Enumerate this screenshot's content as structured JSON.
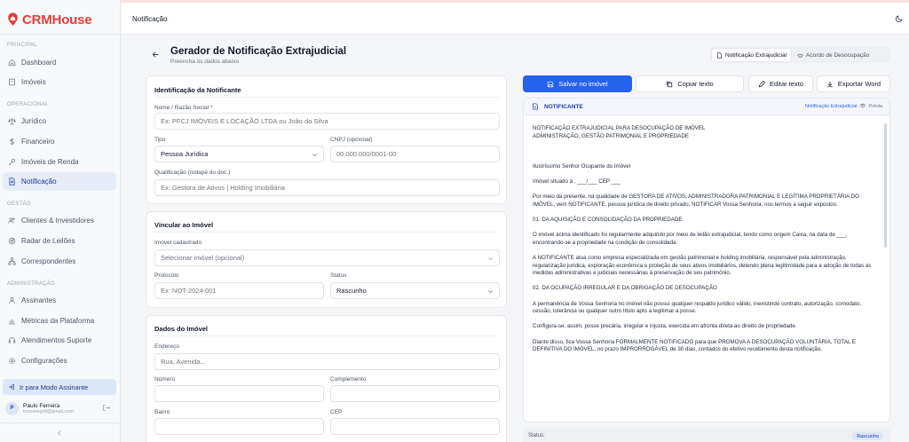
{
  "app": {
    "name": "CRMHouse",
    "brand_color": "#e0403a",
    "accent_color": "#2563eb"
  },
  "header": {
    "title": "Notificação"
  },
  "sidebar": {
    "sections": {
      "principal": "PRINCIPAL",
      "operacional": "OPERACIONAL",
      "gestao": "GESTÃO",
      "administracao": "ADMINISTRAÇÃO"
    },
    "items": [
      {
        "label": "Dashboard",
        "icon": "home-icon"
      },
      {
        "label": "Imóveis",
        "icon": "building-icon"
      },
      {
        "label": "Jurídico",
        "icon": "scale-icon"
      },
      {
        "label": "Financeiro",
        "icon": "dollar-icon"
      },
      {
        "label": "Imóveis de Renda",
        "icon": "key-icon"
      },
      {
        "label": "Notificação",
        "icon": "document-icon",
        "active": true
      },
      {
        "label": "Clientes & Investidores",
        "icon": "users-icon"
      },
      {
        "label": "Radar de Leilões",
        "icon": "radar-icon"
      },
      {
        "label": "Correspondentes",
        "icon": "network-icon"
      },
      {
        "label": "Assinantes",
        "icon": "user-group-icon"
      },
      {
        "label": "Métricas da Plataforma",
        "icon": "chart-icon"
      },
      {
        "label": "Atendimentos Suporte",
        "icon": "headset-icon"
      },
      {
        "label": "Configurações",
        "icon": "gear-icon"
      }
    ],
    "assinante_button": "Ir para Modo Assinante",
    "user": {
      "initial": "P",
      "name": "Paulo Ferreira",
      "email": "imoveisgof@gmail.com"
    }
  },
  "page": {
    "title": "Gerador de Notificação Extrajudicial",
    "subtitle": "Preencha os dados abaixo",
    "tabs": [
      "Notificação Extrajudicial",
      "Acordo de Desocupação"
    ]
  },
  "form": {
    "notificante": {
      "title": "Identificação da Notificante",
      "nome_label": "Nome / Razão Social *",
      "nome_placeholder": "Ex: PFCJ IMÓVEIS E LOCAÇÃO LTDA ou João da Silva",
      "tipo_label": "Tipo",
      "tipo_value": "Pessoa Jurídica",
      "cnpj_label": "CNPJ (opcional)",
      "cnpj_placeholder": "00.000.000/0001-00",
      "qualificacao_label": "Qualificação (rodapé do doc.)",
      "qualificacao_placeholder": "Ex: Gestora de Ativos | Holding Imobiliária"
    },
    "vinculo": {
      "title": "Vincular ao Imóvel",
      "imovel_label": "Imóvel cadastrado",
      "imovel_value": "Selecionar imóvel (opcional)",
      "protocolo_label": "Protocolo",
      "protocolo_placeholder": "Ex: NOT-2024-001",
      "status_label": "Status",
      "status_value": "Rascunho"
    },
    "dados_imovel": {
      "title": "Dados do Imóvel",
      "endereco_label": "Endereço",
      "endereco_placeholder": "Rua, Avenida...",
      "numero_label": "Número",
      "complemento_label": "Complemento",
      "bairro_label": "Bairro",
      "cep_label": "CEP"
    }
  },
  "actions": {
    "save": "Salvar no imóvel",
    "copy": "Copiar texto",
    "edit": "Editar texto",
    "export": "Exportar Word"
  },
  "preview": {
    "header_title": "NOTIFICANTE",
    "header_tag": "Notificação Extrajudicial",
    "header_preview": "Prévia",
    "lines": [
      "NOTIFICAÇÃO EXTRAJUDICIAL PARA DESOCUPAÇÃO DE IMÓVEL",
      "ADMINISTRAÇÃO, GESTÃO PATRIMONIAL E PROPRIEDADE",
      "",
      "Ilustríssimo Senhor Ocupante do Imóvel",
      "Imóvel situado à , ___/___ CEP ___",
      "Por meio da presente, na qualidade de GESTORA DE ATIVOS, ADMINISTRADORA PATRIMONIAL E LEGÍTIMA PROPRIETÁRIA DO IMÓVEL, vem NOTIFICANTE, pessoa jurídica de direito privado, NOTIFICAR Vossa Senhoria, nos termos a seguir expostos:",
      "01. DA AQUISIÇÃO E CONSOLIDAÇÃO DA PROPRIEDADE",
      "O imóvel acima identificado foi regularmente adquirido por meio de leilão extrajudicial, tendo como origem Caixa, na data de ___, encontrando-se a propriedade na condição de consolidada.",
      "A NOTIFICANTE atua como empresa especializada em gestão patrimonial e holding imobiliária, responsável pela administração, regularização jurídica, exploração econômica e proteção de seus ativos imobiliários, detendo plena legitimidade para a adoção de todas as medidas administrativas e judiciais necessárias à preservação de seu patrimônio.",
      "02. DA OCUPAÇÃO IRREGULAR E DA OBRIGAÇÃO DE DESOCUPAÇÃO",
      "A permanência de Vossa Senhoria no imóvel não possui qualquer respaldo jurídico válido, inexistindo contrato, autorização, comodato, cessão, tolerância ou qualquer outro título apto a legitimar a posse.",
      "Configura-se, assim, posse precária, irregular e injusta, exercida em afronta direta ao direito de propriedade.",
      "Diante disso, fica Vossa Senhoria FORMALMENTE NOTIFICADO para que PROMOVA A DESOCUPAÇÃO VOLUNTÁRIA, TOTAL E DEFINITIVA DO IMÓVEL, no prazo IMPRORROGÁVEL de 30 dias, contados do efetivo recebimento desta notificação."
    ]
  },
  "status_bar": {
    "label": "Status:",
    "value": "Rascunho"
  }
}
